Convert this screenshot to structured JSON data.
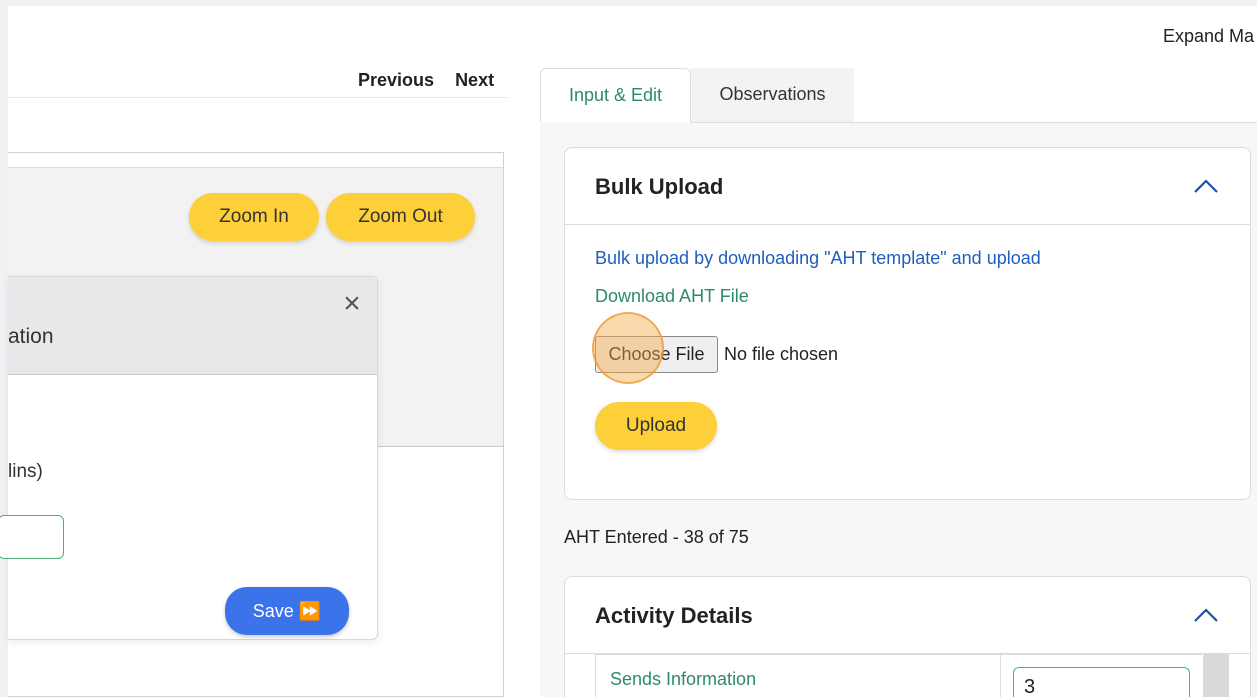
{
  "header": {
    "expand_label": "Expand Ma"
  },
  "navigation": {
    "previous": "Previous",
    "next": "Next"
  },
  "canvas": {
    "zoom_in": "Zoom In",
    "zoom_out": "Zoom Out"
  },
  "modal": {
    "title_partial": "ation",
    "close_symbol": "×",
    "field_label_partial": "lins)",
    "save_label": "Save ⏩"
  },
  "tabs": [
    {
      "label": "Input & Edit",
      "active": true
    },
    {
      "label": "Observations",
      "active": false
    }
  ],
  "bulk_upload": {
    "title": "Bulk Upload",
    "instruction": "Bulk upload by downloading \"AHT template\" and upload",
    "download_link": "Download AHT File",
    "choose_file": "Choose File",
    "no_file": "No file chosen",
    "upload_label": "Upload"
  },
  "aht_status": "AHT Entered - 38 of 75",
  "activity_details": {
    "title": "Activity Details",
    "rows": [
      {
        "label": "Sends Information",
        "value": "3"
      }
    ]
  },
  "icons": {
    "collapse": "chevron-up-icon",
    "close": "close-icon"
  },
  "colors": {
    "accent_yellow": "#fdd03a",
    "primary_blue": "#3b73ea",
    "link_green": "#2e8a6a",
    "link_blue": "#1e5fbf"
  }
}
